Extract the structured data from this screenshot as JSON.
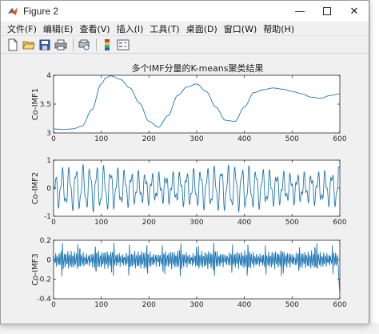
{
  "window": {
    "title": "Figure 2"
  },
  "menu": [
    "文件(F)",
    "编辑(E)",
    "查看(V)",
    "插入(I)",
    "工具(T)",
    "桌面(D)",
    "窗口(W)",
    "帮助(H)"
  ],
  "toolbar": {
    "icons": [
      "new-file-icon",
      "open-folder-icon",
      "save-icon",
      "print-icon",
      "print-preview-icon",
      "colorbar-icon",
      "legend-icon"
    ]
  },
  "figure": {
    "title": "多个IMF分量的K-means聚类结果"
  },
  "accent_color": "#1f77b4",
  "chart_data": [
    {
      "type": "line",
      "ylabel": "Co-IMF1",
      "xlim": [
        0,
        600
      ],
      "ylim": [
        3,
        4
      ],
      "xticks": [
        "0",
        "100",
        "200",
        "300",
        "400",
        "500",
        "600"
      ],
      "yticks": [
        "3",
        "3.5",
        "4"
      ],
      "x": [
        0,
        20,
        40,
        60,
        80,
        100,
        110,
        120,
        140,
        160,
        180,
        200,
        220,
        240,
        260,
        280,
        300,
        320,
        340,
        360,
        380,
        400,
        420,
        440,
        460,
        480,
        500,
        520,
        540,
        560,
        580,
        600
      ],
      "y": [
        3.07,
        3.06,
        3.07,
        3.12,
        3.4,
        3.85,
        3.96,
        3.99,
        3.93,
        3.78,
        3.52,
        3.2,
        3.1,
        3.3,
        3.65,
        3.8,
        3.85,
        3.72,
        3.45,
        3.22,
        3.2,
        3.45,
        3.7,
        3.75,
        3.78,
        3.76,
        3.72,
        3.68,
        3.62,
        3.6,
        3.65,
        3.68
      ]
    },
    {
      "type": "line",
      "ylabel": "Co-IMF2",
      "xlim": [
        0,
        600
      ],
      "ylim": [
        -1,
        1
      ],
      "xticks": [
        "0",
        "100",
        "200",
        "300",
        "400",
        "500",
        "600"
      ],
      "yticks": [
        "-1",
        "0",
        "1"
      ],
      "signal": {
        "amplitude": 0.65,
        "period_x": 14.5,
        "secondary_amplitude": 0.22,
        "secondary_period_x": 6.1
      }
    },
    {
      "type": "line",
      "ylabel": "Co-IMF3",
      "xlim": [
        0,
        600
      ],
      "ylim": [
        -0.4,
        0.2
      ],
      "xticks": [
        "0",
        "100",
        "200",
        "300",
        "400",
        "500",
        "600"
      ],
      "yticks": [
        "-0.4",
        "-0.2",
        "0",
        "0.2"
      ],
      "signal": {
        "amplitude": 0.07,
        "period_x": 3.6,
        "burst_amplitude": 0.14,
        "min_value": -0.36
      }
    }
  ]
}
